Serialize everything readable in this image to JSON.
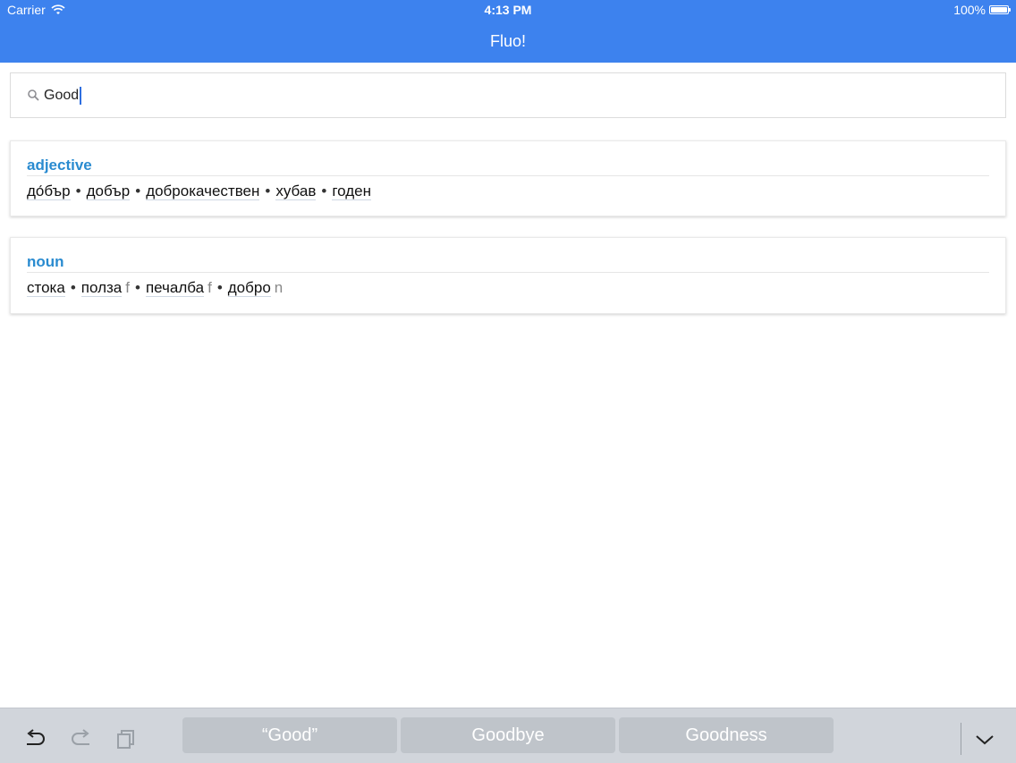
{
  "status": {
    "carrier": "Carrier",
    "time": "4:13 PM",
    "battery": "100%"
  },
  "app": {
    "title": "Fluo!"
  },
  "search": {
    "query": "Good"
  },
  "results": [
    {
      "pos": "adjective",
      "words": [
        {
          "text": "до́бър",
          "gender": ""
        },
        {
          "text": "добър",
          "gender": ""
        },
        {
          "text": "доброкачествен",
          "gender": ""
        },
        {
          "text": "хубав",
          "gender": ""
        },
        {
          "text": "годен",
          "gender": ""
        }
      ]
    },
    {
      "pos": "noun",
      "words": [
        {
          "text": "стока",
          "gender": ""
        },
        {
          "text": "полза",
          "gender": "f"
        },
        {
          "text": "печалба",
          "gender": "f"
        },
        {
          "text": "добро",
          "gender": "n"
        }
      ]
    }
  ],
  "separator": "•",
  "keyboard": {
    "suggestions": [
      "“Good”",
      "Goodbye",
      "Goodness"
    ]
  },
  "colors": {
    "header": "#3d82ee",
    "pos": "#2a8bd0"
  },
  "icons": {
    "wifi": "wifi-icon",
    "battery": "battery-icon",
    "search": "search-icon",
    "undo": "undo-icon",
    "redo": "redo-icon",
    "paste": "paste-icon",
    "dismiss": "chevron-down-icon"
  }
}
